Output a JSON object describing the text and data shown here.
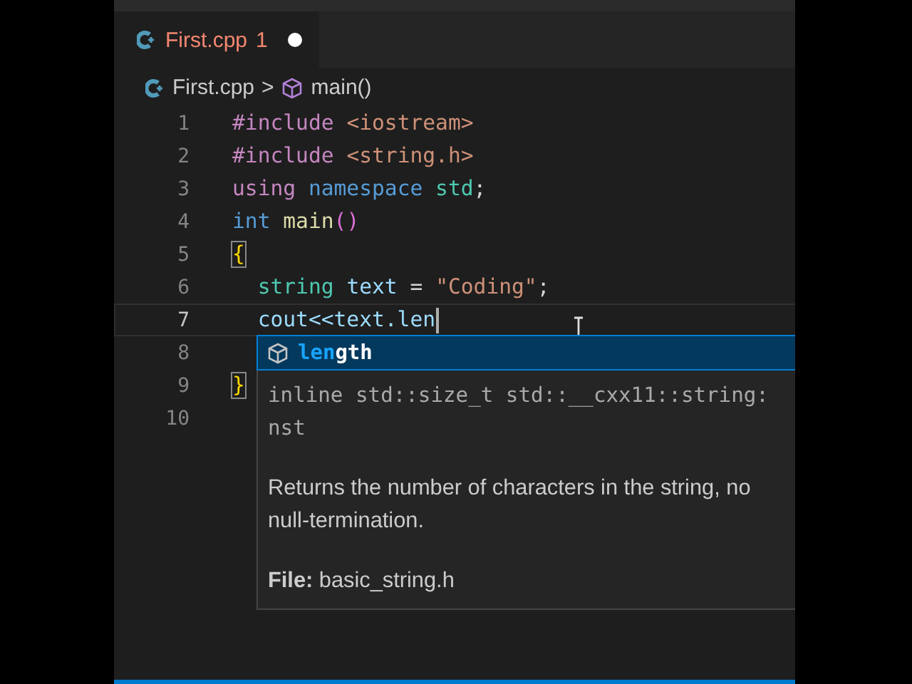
{
  "tab": {
    "label": "First.cpp",
    "problems": "1",
    "modified": true,
    "selected": true
  },
  "breadcrumb": {
    "file": "First.cpp",
    "separator": ">",
    "symbol": "main()"
  },
  "lines": [
    {
      "number": "1",
      "current": false,
      "tokens": [
        {
          "text": "#include",
          "kind": "keyword"
        },
        {
          "text": " <iostream>",
          "kind": "string"
        }
      ]
    },
    {
      "number": "2",
      "current": false,
      "tokens": [
        {
          "text": "#include",
          "kind": "keyword"
        },
        {
          "text": " <string.h>",
          "kind": "string"
        }
      ]
    },
    {
      "number": "3",
      "current": false,
      "tokens": [
        {
          "text": "using",
          "kind": "keyword"
        },
        {
          "text": " namespace",
          "kind": "storage"
        },
        {
          "text": " std",
          "kind": "type"
        },
        {
          "text": ";",
          "kind": "plain"
        }
      ]
    },
    {
      "number": "4",
      "current": false,
      "tokens": [
        {
          "text": "int",
          "kind": "storage"
        },
        {
          "text": " main",
          "kind": "function"
        },
        {
          "text": "()",
          "kind": "bracket"
        }
      ]
    },
    {
      "number": "5",
      "current": false,
      "tokens": [
        {
          "text": "{",
          "kind": "match"
        }
      ]
    },
    {
      "number": "6",
      "current": false,
      "tokens": [
        {
          "text": "  string",
          "kind": "type"
        },
        {
          "text": " text",
          "kind": "variable"
        },
        {
          "text": " = ",
          "kind": "plain"
        },
        {
          "text": "\"Coding\"",
          "kind": "string"
        },
        {
          "text": ";",
          "kind": "plain"
        }
      ]
    },
    {
      "number": "7",
      "current": true,
      "tokens": [
        {
          "text": "  cout<<text.len",
          "kind": "variable"
        }
      ]
    },
    {
      "number": "8",
      "current": false
    },
    {
      "number": "9",
      "current": false,
      "tokens": [
        {
          "text": "}",
          "kind": "match"
        }
      ]
    },
    {
      "number": "10",
      "current": false
    }
  ],
  "suggestion": {
    "match": "len",
    "rest": "gth",
    "selected": true,
    "signature": [
      "inline std::size_t std::__cxx11::string:",
      "nst"
    ],
    "description": [
      "Returns the number of characters in the string, no",
      "null-termination."
    ],
    "file": "**File:** basic_string.h"
  }
}
